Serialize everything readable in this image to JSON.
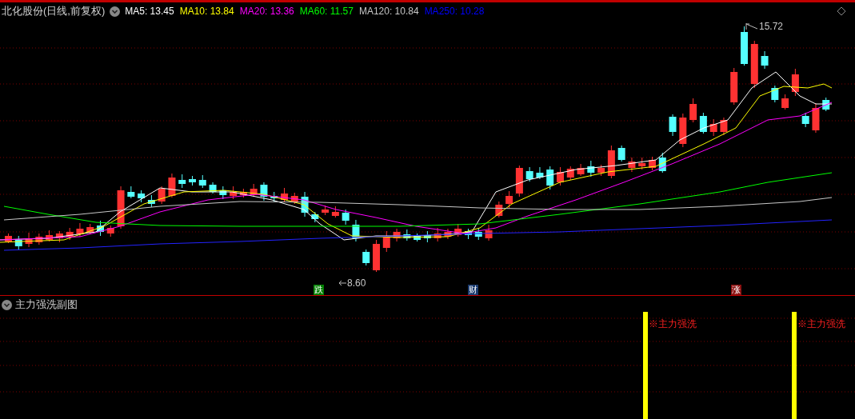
{
  "main_chart": {
    "title": "北化股份(日线,前复权)",
    "ma_legend": [
      {
        "label": "MA5: 13.45",
        "color": "#ffffff"
      },
      {
        "label": "MA10: 13.84",
        "color": "#ffff00"
      },
      {
        "label": "MA20: 13.36",
        "color": "#ff00ff"
      },
      {
        "label": "MA60: 11.57",
        "color": "#00ff00"
      },
      {
        "label": "MA120: 10.84",
        "color": "#c8c8c8"
      },
      {
        "label": "MA250: 10.28",
        "color": "#0000ff"
      }
    ],
    "high_label": "15.72",
    "low_label": "8.60",
    "event_markers": [
      {
        "label": "跌",
        "color": "#008000"
      },
      {
        "label": "财",
        "color": "#1a3a6e"
      },
      {
        "label": "涨",
        "color": "#8b1010"
      }
    ]
  },
  "sub_chart": {
    "title": "主力强洗副图",
    "signals": [
      "※主力强洗",
      "※主力强洗"
    ]
  }
}
